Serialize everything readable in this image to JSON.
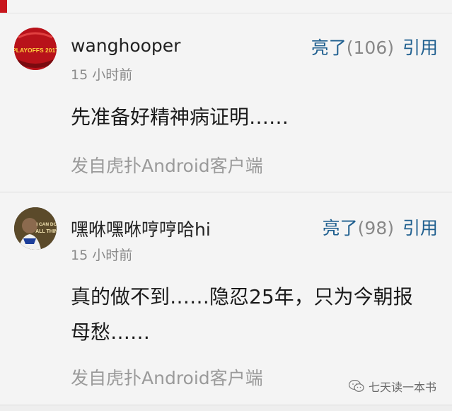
{
  "colors": {
    "accent": "#c8161d",
    "link": "#1f5f8f"
  },
  "comments": [
    {
      "username": "wanghooper",
      "avatar_icon": "playoffs-2017-avatar",
      "avatar_text": "PLAYOFFS 2017",
      "time": "15 小时前",
      "like_label": "亮了",
      "like_count": "(106)",
      "quote_label": "引用",
      "content": "先准备好精神病证明……",
      "source": "发自虎扑Android客户端"
    },
    {
      "username": "嘿咻嘿咻哼哼哈hi",
      "avatar_icon": "player-photo-avatar",
      "avatar_text": "I CAN DO ALL THIN",
      "time": "15 小时前",
      "like_label": "亮了",
      "like_count": "(98)",
      "quote_label": "引用",
      "content": "真的做不到……隐忍25年，只为今朝报母愁……",
      "source": "发自虎扑Android客户端"
    }
  ],
  "watermark": {
    "icon": "wechat-icon",
    "text": "七天读一本书"
  }
}
